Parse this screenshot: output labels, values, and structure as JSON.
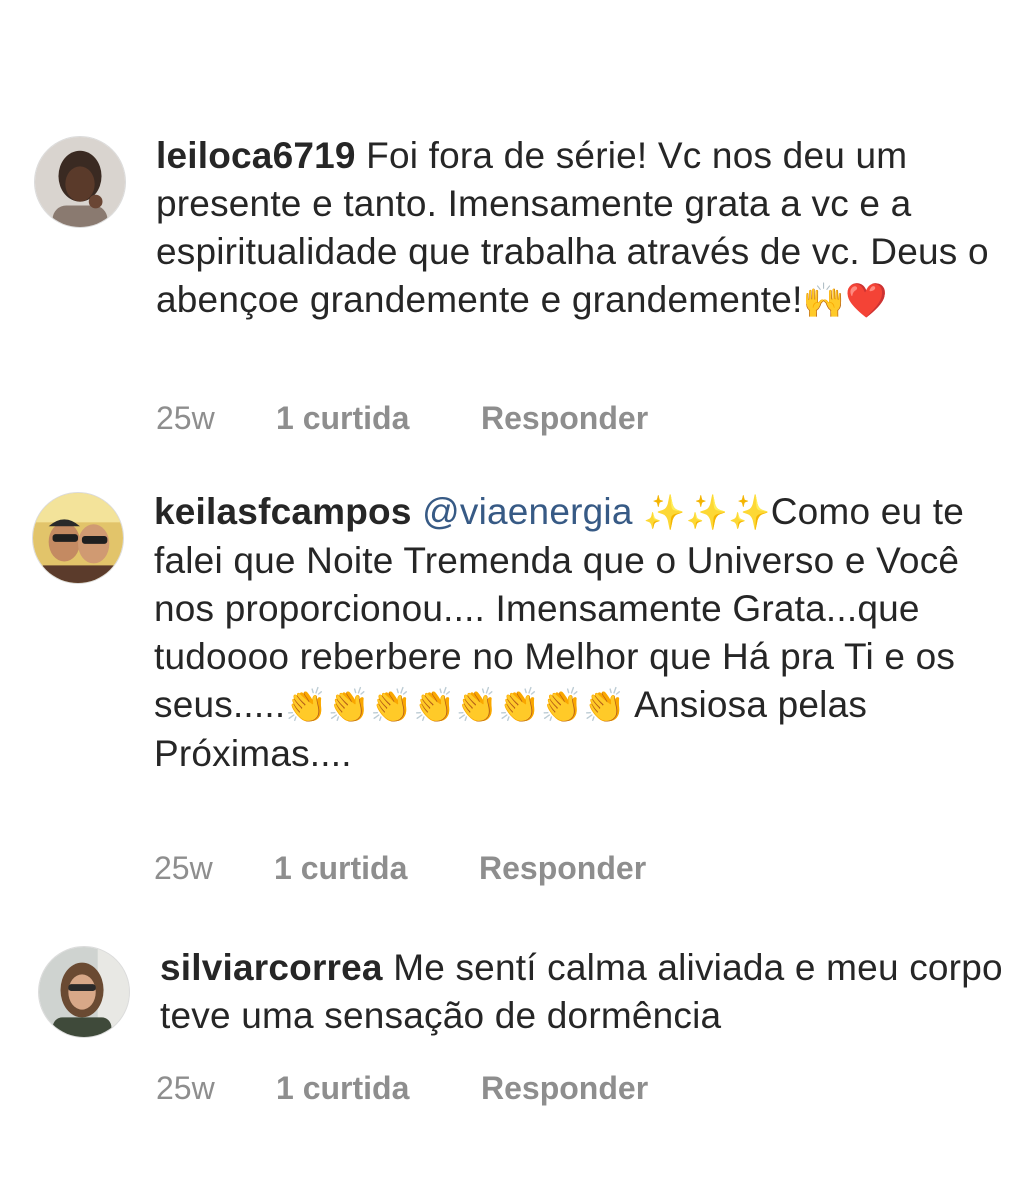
{
  "comments": [
    {
      "username": "leiloca6719",
      "mention": "",
      "text": "Foi fora de série! Vc nos deu um presente e tanto. Imensamente grata a vc e a espiritualidade que trabalha através de vc. Deus o abençoe grandemente e grandemente!",
      "emoji_trailing": "🙌❤️",
      "time": "25w",
      "likes": "1 curtida",
      "reply": "Responder",
      "avatar_icon": "profile-photo"
    },
    {
      "username": "keilasfcampos",
      "mention": "@viaenergia",
      "emoji_leading": "✨✨✨",
      "text": "Como eu te falei que Noite Tremenda que o Universo e Você nos proporcionou.... Imensamente Grata...que tudoooo reberbere no Melhor que Há pra Ti e os seus.....",
      "emoji_middle": "👏👏👏👏👏👏👏👏",
      "text2": "Ansiosa pelas Próximas....",
      "time": "25w",
      "likes": "1 curtida",
      "reply": "Responder",
      "avatar_icon": "profile-photo"
    },
    {
      "username": "silviarcorrea",
      "mention": "",
      "text": "Me sentí calma aliviada e meu corpo teve uma sensação de dormência",
      "time": "25w",
      "likes": "1 curtida",
      "reply": "Responder",
      "avatar_icon": "profile-photo"
    }
  ]
}
